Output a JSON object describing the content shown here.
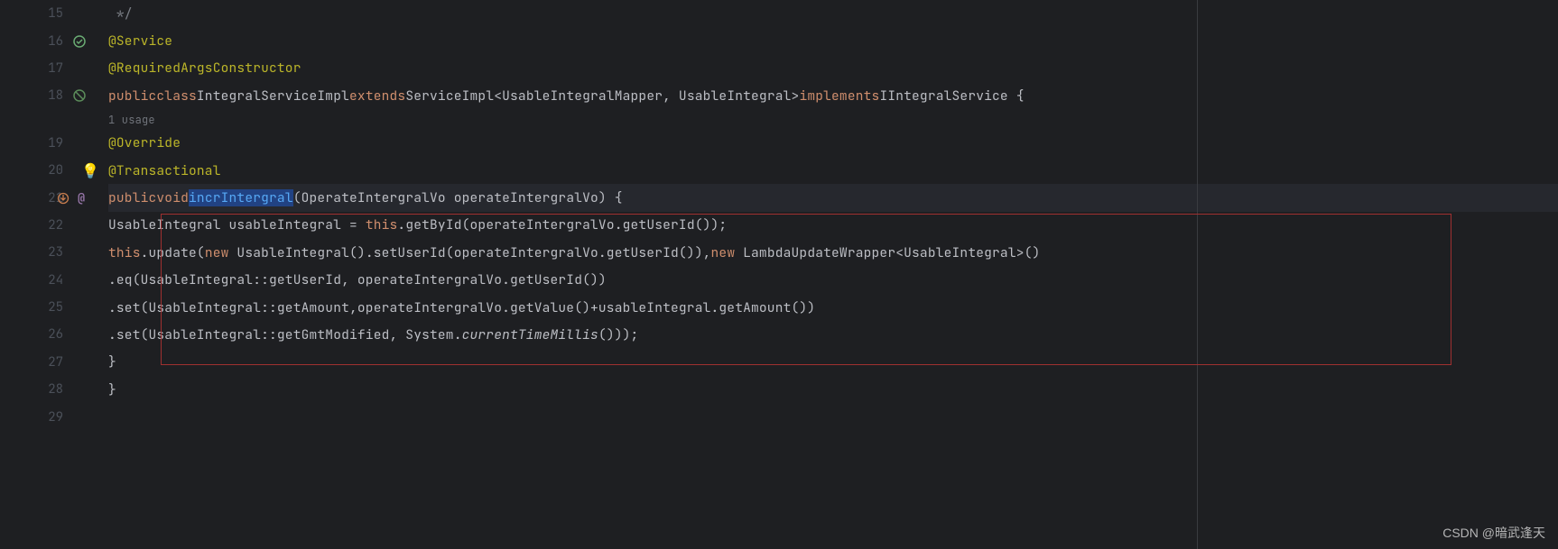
{
  "lines": {
    "15": {
      "num": "15"
    },
    "16": {
      "num": "16"
    },
    "17": {
      "num": "17"
    },
    "18": {
      "num": "18"
    },
    "19": {
      "num": "19"
    },
    "20": {
      "num": "20"
    },
    "21": {
      "num": "21"
    },
    "22": {
      "num": "22"
    },
    "23": {
      "num": "23"
    },
    "24": {
      "num": "24"
    },
    "25": {
      "num": "25"
    },
    "26": {
      "num": "26"
    },
    "27": {
      "num": "27"
    },
    "28": {
      "num": "28"
    },
    "29": {
      "num": "29"
    }
  },
  "code": {
    "l15_comment_end": " */",
    "l16_annotation": "@Service",
    "l17_annotation": "@RequiredArgsConstructor",
    "l18_public": "public",
    "l18_class": "class",
    "l18_name": "IntegralServiceImpl",
    "l18_extends": "extends",
    "l18_super": "ServiceImpl<UsableIntegralMapper, UsableIntegral>",
    "l18_implements": "implements",
    "l18_iface": "IIntegralService {",
    "l18_hint": "1 usage",
    "l19_annotation": "@Override",
    "l20_annotation": "@Transactional",
    "l21_public": "public",
    "l21_void": "void",
    "l21_method": "incrIntergral",
    "l21_params": "(OperateIntergralVo operateIntergralVo) {",
    "l22_type": "UsableIntegral usableIntegral = ",
    "l22_this": "this",
    "l22_rest": ".getById(operateIntergralVo.getUserId());",
    "l23_this": "this",
    "l23_update": ".update(",
    "l23_new1": "new",
    "l23_mid": " UsableIntegral().setUserId(operateIntergralVo.getUserId()),",
    "l23_new2": "new",
    "l23_end": " LambdaUpdateWrapper<UsableIntegral>()",
    "l24": ".eq(UsableIntegral::getUserId, operateIntergralVo.getUserId())",
    "l25": ".set(UsableIntegral::getAmount,operateIntergralVo.getValue()+usableIntegral.getAmount())",
    "l26_a": ".set(UsableIntegral::getGmtModified, System.",
    "l26_b": "currentTimeMillis",
    "l26_c": "()));",
    "l27": "}",
    "l28": "}"
  },
  "watermark": "CSDN @暗武逢天",
  "icons": {
    "lightbulb": "lightbulb-icon",
    "run_ok": "run-ok-icon",
    "class_icon": "class-override-icon",
    "method_icon": "method-override-icon",
    "at_icon": "annotation-icon"
  }
}
